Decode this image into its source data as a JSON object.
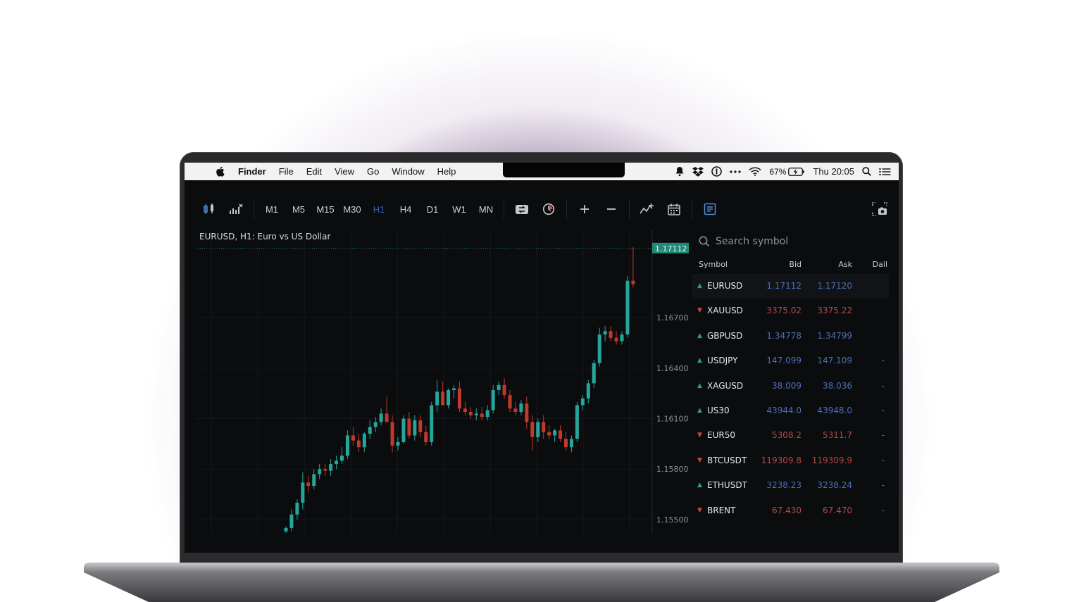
{
  "menubar": {
    "app": "Finder",
    "items": [
      "File",
      "Edit",
      "View",
      "Go",
      "Window",
      "Help"
    ],
    "battery": "67%",
    "clock": "Thu 20:05"
  },
  "toolbar": {
    "timeframes": [
      "M1",
      "M5",
      "M15",
      "M30",
      "H1",
      "H4",
      "D1",
      "W1",
      "MN"
    ],
    "active_timeframe": "H1",
    "icons": [
      "candlestick-chart-icon",
      "indicators-icon",
      "one-click-trading-icon",
      "history-icon",
      "zoom-in-icon",
      "zoom-out-icon",
      "indicators-line-icon",
      "calendar-icon",
      "order-book-icon",
      "screenshot-icon"
    ]
  },
  "chart": {
    "title": "EURUSD, H1: Euro vs US Dollar",
    "current_price": "1.17112",
    "price_labels": [
      "1.16700",
      "1.16400",
      "1.16100",
      "1.15800",
      "1.15500"
    ],
    "colors": {
      "up": "#26a69a",
      "down": "#c0392b",
      "grid": "#15171a"
    }
  },
  "chart_data": {
    "type": "candlestick",
    "title": "EURUSD, H1: Euro vs US Dollar",
    "y_ticks": [
      1.155,
      1.158,
      1.161,
      1.164,
      1.167
    ],
    "ylim": [
      1.1542,
      1.1722
    ],
    "last_price": 1.17112,
    "candles": [
      {
        "o": 1.1543,
        "h": 1.1546,
        "l": 1.1539,
        "c": 1.1545
      },
      {
        "o": 1.1545,
        "h": 1.1556,
        "l": 1.1543,
        "c": 1.1553
      },
      {
        "o": 1.1553,
        "h": 1.1562,
        "l": 1.155,
        "c": 1.156
      },
      {
        "o": 1.156,
        "h": 1.1578,
        "l": 1.1556,
        "c": 1.1572
      },
      {
        "o": 1.1572,
        "h": 1.1576,
        "l": 1.1566,
        "c": 1.157
      },
      {
        "o": 1.157,
        "h": 1.158,
        "l": 1.1568,
        "c": 1.1577
      },
      {
        "o": 1.1577,
        "h": 1.1583,
        "l": 1.1574,
        "c": 1.158
      },
      {
        "o": 1.158,
        "h": 1.1583,
        "l": 1.1576,
        "c": 1.1579
      },
      {
        "o": 1.1579,
        "h": 1.1586,
        "l": 1.1576,
        "c": 1.1583
      },
      {
        "o": 1.1583,
        "h": 1.1588,
        "l": 1.158,
        "c": 1.1585
      },
      {
        "o": 1.1585,
        "h": 1.1593,
        "l": 1.1583,
        "c": 1.1588
      },
      {
        "o": 1.1588,
        "h": 1.1603,
        "l": 1.1586,
        "c": 1.16
      },
      {
        "o": 1.16,
        "h": 1.1605,
        "l": 1.1594,
        "c": 1.1597
      },
      {
        "o": 1.1597,
        "h": 1.1601,
        "l": 1.159,
        "c": 1.1593
      },
      {
        "o": 1.1593,
        "h": 1.1602,
        "l": 1.159,
        "c": 1.1601
      },
      {
        "o": 1.1601,
        "h": 1.1609,
        "l": 1.1598,
        "c": 1.1605
      },
      {
        "o": 1.1605,
        "h": 1.1611,
        "l": 1.1602,
        "c": 1.1608
      },
      {
        "o": 1.1608,
        "h": 1.1616,
        "l": 1.1606,
        "c": 1.1613
      },
      {
        "o": 1.1613,
        "h": 1.1623,
        "l": 1.161,
        "c": 1.1608
      },
      {
        "o": 1.1608,
        "h": 1.1612,
        "l": 1.159,
        "c": 1.1594
      },
      {
        "o": 1.1594,
        "h": 1.1599,
        "l": 1.1591,
        "c": 1.1596
      },
      {
        "o": 1.1596,
        "h": 1.1612,
        "l": 1.1595,
        "c": 1.161
      },
      {
        "o": 1.161,
        "h": 1.1614,
        "l": 1.1598,
        "c": 1.16
      },
      {
        "o": 1.16,
        "h": 1.1612,
        "l": 1.1597,
        "c": 1.1609
      },
      {
        "o": 1.1609,
        "h": 1.1612,
        "l": 1.1599,
        "c": 1.1602
      },
      {
        "o": 1.1602,
        "h": 1.1606,
        "l": 1.1594,
        "c": 1.1596
      },
      {
        "o": 1.1596,
        "h": 1.162,
        "l": 1.1594,
        "c": 1.1618
      },
      {
        "o": 1.1618,
        "h": 1.1633,
        "l": 1.1614,
        "c": 1.1626
      },
      {
        "o": 1.1626,
        "h": 1.1632,
        "l": 1.1618,
        "c": 1.1618
      },
      {
        "o": 1.1618,
        "h": 1.1628,
        "l": 1.1616,
        "c": 1.1627
      },
      {
        "o": 1.1627,
        "h": 1.163,
        "l": 1.1622,
        "c": 1.1628
      },
      {
        "o": 1.1628,
        "h": 1.1632,
        "l": 1.1614,
        "c": 1.1616
      },
      {
        "o": 1.1616,
        "h": 1.162,
        "l": 1.1612,
        "c": 1.1614
      },
      {
        "o": 1.1614,
        "h": 1.1617,
        "l": 1.161,
        "c": 1.1612
      },
      {
        "o": 1.1612,
        "h": 1.1616,
        "l": 1.1609,
        "c": 1.1613
      },
      {
        "o": 1.1613,
        "h": 1.1617,
        "l": 1.1609,
        "c": 1.1611
      },
      {
        "o": 1.1611,
        "h": 1.1618,
        "l": 1.1609,
        "c": 1.1615
      },
      {
        "o": 1.1615,
        "h": 1.163,
        "l": 1.1613,
        "c": 1.1627
      },
      {
        "o": 1.1627,
        "h": 1.1632,
        "l": 1.1624,
        "c": 1.163
      },
      {
        "o": 1.163,
        "h": 1.1634,
        "l": 1.1622,
        "c": 1.1624
      },
      {
        "o": 1.1624,
        "h": 1.1627,
        "l": 1.1614,
        "c": 1.1616
      },
      {
        "o": 1.1616,
        "h": 1.162,
        "l": 1.1612,
        "c": 1.1614
      },
      {
        "o": 1.1614,
        "h": 1.1621,
        "l": 1.1612,
        "c": 1.1619
      },
      {
        "o": 1.1619,
        "h": 1.1623,
        "l": 1.1604,
        "c": 1.1608
      },
      {
        "o": 1.1608,
        "h": 1.1612,
        "l": 1.1591,
        "c": 1.1599
      },
      {
        "o": 1.1599,
        "h": 1.161,
        "l": 1.1596,
        "c": 1.1608
      },
      {
        "o": 1.1608,
        "h": 1.1612,
        "l": 1.1598,
        "c": 1.1602
      },
      {
        "o": 1.1602,
        "h": 1.1606,
        "l": 1.1598,
        "c": 1.16
      },
      {
        "o": 1.16,
        "h": 1.1604,
        "l": 1.1596,
        "c": 1.1603
      },
      {
        "o": 1.1603,
        "h": 1.1606,
        "l": 1.1596,
        "c": 1.1598
      },
      {
        "o": 1.1598,
        "h": 1.1602,
        "l": 1.1591,
        "c": 1.1593
      },
      {
        "o": 1.1593,
        "h": 1.16,
        "l": 1.159,
        "c": 1.1598
      },
      {
        "o": 1.1598,
        "h": 1.162,
        "l": 1.1596,
        "c": 1.1618
      },
      {
        "o": 1.1618,
        "h": 1.1624,
        "l": 1.1615,
        "c": 1.1622
      },
      {
        "o": 1.1622,
        "h": 1.1633,
        "l": 1.1619,
        "c": 1.1631
      },
      {
        "o": 1.1631,
        "h": 1.1645,
        "l": 1.1628,
        "c": 1.1643
      },
      {
        "o": 1.1643,
        "h": 1.1664,
        "l": 1.1641,
        "c": 1.166
      },
      {
        "o": 1.166,
        "h": 1.1665,
        "l": 1.1656,
        "c": 1.1662
      },
      {
        "o": 1.1662,
        "h": 1.1665,
        "l": 1.1656,
        "c": 1.1658
      },
      {
        "o": 1.1658,
        "h": 1.1662,
        "l": 1.1654,
        "c": 1.1656
      },
      {
        "o": 1.1656,
        "h": 1.1662,
        "l": 1.1654,
        "c": 1.166
      },
      {
        "o": 1.166,
        "h": 1.1695,
        "l": 1.1658,
        "c": 1.1692
      },
      {
        "o": 1.1692,
        "h": 1.1712,
        "l": 1.1688,
        "c": 1.169
      }
    ]
  },
  "watchlist": {
    "search_placeholder": "Search symbol",
    "headers": {
      "symbol": "Symbol",
      "bid": "Bid",
      "ask": "Ask",
      "daily": "Dail"
    },
    "rows": [
      {
        "symbol": "EURUSD",
        "bid": "1.17112",
        "ask": "1.17120",
        "dir": "up",
        "daily": ""
      },
      {
        "symbol": "XAUUSD",
        "bid": "3375.02",
        "ask": "3375.22",
        "dir": "dn",
        "daily": ""
      },
      {
        "symbol": "GBPUSD",
        "bid": "1.34778",
        "ask": "1.34799",
        "dir": "up",
        "daily": ""
      },
      {
        "symbol": "USDJPY",
        "bid": "147.099",
        "ask": "147.109",
        "dir": "up",
        "daily": "-"
      },
      {
        "symbol": "XAGUSD",
        "bid": "38.009",
        "ask": "38.036",
        "dir": "up",
        "daily": "-"
      },
      {
        "symbol": "US30",
        "bid": "43944.0",
        "ask": "43948.0",
        "dir": "up",
        "daily": "-"
      },
      {
        "symbol": "EUR50",
        "bid": "5308.2",
        "ask": "5311.7",
        "dir": "dn",
        "daily": "-"
      },
      {
        "symbol": "BTCUSDT",
        "bid": "119309.8",
        "ask": "119309.9",
        "dir": "dn",
        "daily": "-"
      },
      {
        "symbol": "ETHUSDT",
        "bid": "3238.23",
        "ask": "3238.24",
        "dir": "up",
        "daily": "-"
      },
      {
        "symbol": "BRENT",
        "bid": "67.430",
        "ask": "67.470",
        "dir": "dn",
        "daily": "-"
      }
    ]
  }
}
